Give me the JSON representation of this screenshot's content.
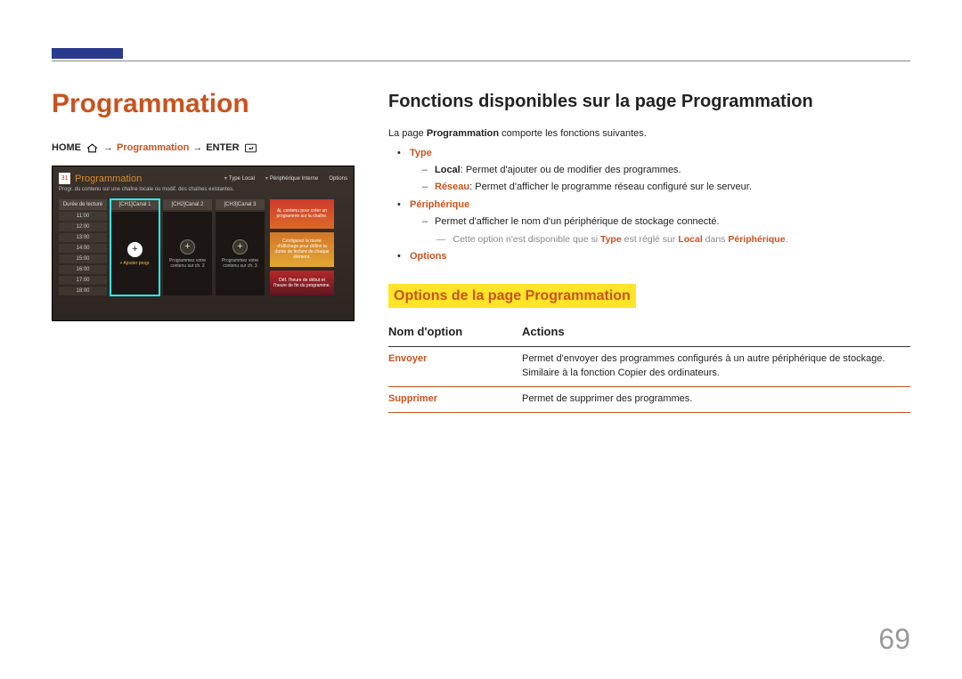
{
  "page": {
    "title": "Programmation",
    "number": "69"
  },
  "breadcrumb": {
    "home": "HOME",
    "arrow": "→",
    "middle": "Programmation",
    "enter": "ENTER"
  },
  "device": {
    "calendar_num": "31",
    "title": "Programmation",
    "subtitle": "Progr. du contenu sur une chaîne locale ou modif. des chaînes existantes.",
    "controls": {
      "type_label": "Type",
      "type_value": "Local",
      "periph_label": "Périphérique",
      "periph_value": "Interne",
      "options": "Options"
    },
    "time_header": "Durée de lecture",
    "times": [
      "11:00",
      "12:00",
      "13:00",
      "14:00",
      "15:00",
      "16:00",
      "17:00",
      "18:00"
    ],
    "channels": [
      {
        "header": "[CH1]Canal 1",
        "plus_label": "+ Ajouter progr.",
        "caption": ""
      },
      {
        "header": "[CH2]Canal 2",
        "plus_label": "",
        "caption": "Programmez votre contenu sur ch. 2"
      },
      {
        "header": "[CH3]Canal 3",
        "plus_label": "",
        "caption": "Programmez votre contenu sur ch. 3"
      }
    ],
    "side": {
      "box1": "Aj. contenu pour créer un programme sur la chaîne.",
      "box2": "Configurez la durée d'affichage pour définir la durée de lecture de chaque élément.",
      "box3": "Déf. l'heure de début et l'heure de fin du programme."
    }
  },
  "right": {
    "heading": "Fonctions disponibles sur la page Programmation",
    "intro_pre": "La page ",
    "intro_bold": "Programmation",
    "intro_post": " comporte les fonctions suivantes.",
    "items": {
      "type": {
        "name": "Type",
        "local_key": "Local",
        "local_desc": ": Permet d'ajouter ou de modifier des programmes.",
        "reseau_key": "Réseau",
        "reseau_desc": ": Permet d'afficher le programme réseau configuré sur le serveur."
      },
      "periph": {
        "name": "Périphérique",
        "desc": "Permet d'afficher le nom d'un périphérique de stockage connecté.",
        "note_pre": "Cette option n'est disponible que si ",
        "note_type": "Type",
        "note_mid": " est réglé sur ",
        "note_local": "Local",
        "note_mid2": " dans ",
        "note_periph": "Périphérique",
        "note_end": "."
      },
      "options": {
        "name": "Options"
      }
    },
    "sub_heading": "Options de la page Programmation",
    "table": {
      "col1": "Nom d'option",
      "col2": "Actions",
      "rows": [
        {
          "name": "Envoyer",
          "desc1": "Permet d'envoyer des programmes configurés à un autre périphérique de stockage.",
          "desc2": "Similaire à la fonction Copier des ordinateurs."
        },
        {
          "name": "Supprimer",
          "desc1": "Permet de supprimer des programmes.",
          "desc2": ""
        }
      ]
    }
  }
}
